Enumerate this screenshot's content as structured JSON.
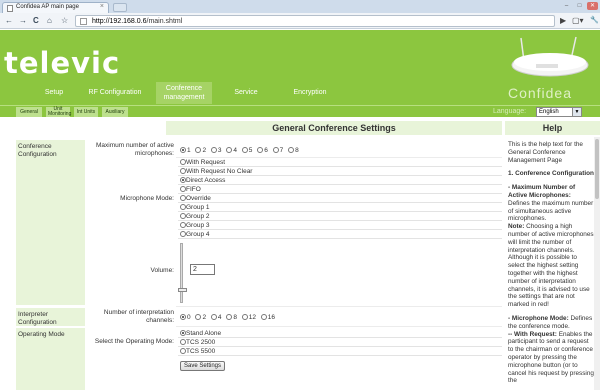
{
  "browser": {
    "tab_title": "Confidea AP main page",
    "tab_close": "×",
    "url_host": "http://192.168.0.6",
    "url_path": "/main.shtml",
    "back": "←",
    "forward": "→",
    "reload": "C",
    "home": "⌂",
    "star": "☆",
    "go": "▶",
    "page_menu": "▢▾",
    "tools_menu": "🔧",
    "win_min": "–",
    "win_max": "□",
    "win_close": "✕"
  },
  "header": {
    "logo": "televic",
    "brand": "Confidea",
    "nav": [
      {
        "label": "Setup"
      },
      {
        "label": "RF Configuration"
      },
      {
        "label": "Conference management"
      },
      {
        "label": "Service"
      },
      {
        "label": "Encryption"
      }
    ],
    "subnav": [
      {
        "label": "General"
      },
      {
        "label": "Unit Monitoring"
      },
      {
        "label": "Int Units"
      },
      {
        "label": "Auxiliary"
      }
    ],
    "language_label": "Language:",
    "language_value": "English"
  },
  "main": {
    "title": "General Conference Settings",
    "sections": {
      "conference": "Conference Configuration",
      "interpreter": "Interpreter Configuration",
      "operating": "Operating Mode"
    },
    "max_mics_label": "Maximum number of active microphones:",
    "max_mics_options": [
      "1",
      "2",
      "3",
      "4",
      "5",
      "6",
      "7",
      "8"
    ],
    "max_mics_selected": "1",
    "mic_mode_label": "Microphone Mode:",
    "mic_mode_options": [
      "With Request",
      "With Request No Clear",
      "Direct Access",
      "FIFO",
      "Override",
      "Group 1",
      "Group 2",
      "Group 3",
      "Group 4"
    ],
    "mic_mode_selected": "Direct Access",
    "volume_label": "Volume:",
    "volume_value": "2",
    "volume_level": 0.2,
    "interp_label": "Number of interpretation channels:",
    "interp_options": [
      "0",
      "2",
      "4",
      "8",
      "12",
      "16"
    ],
    "interp_selected": "0",
    "opmode_label": "Select the Operating Mode:",
    "opmode_options": [
      "Stand Alone",
      "TCS 2500",
      "TCS 5500"
    ],
    "opmode_selected": "Stand Alone",
    "save_label": "Save Settings"
  },
  "help": {
    "title": "Help",
    "p1": "This is the help text for the General Conference Management Page",
    "h1": "1. Conference Configuration",
    "p2a": "- Maximum Number of Active Microphones:",
    "p2b": " Defines the maximum number of simultaneous active microphones.",
    "p3a": "Note:",
    "p3b": " Choosing a high number of active microphones will limit the number of interpretation channels. Although it is possible to select the highest setting together with the highest number of interpretation channels, it is advised to use the settings that are not marked in red!",
    "p4a": "- Microphone Mode:",
    "p4b": " Defines the conference mode.",
    "p5a": "-- With Request:",
    "p5b": " Enables the participant to send a request to the chairman or conference operator by pressing the microphone button (or to cancel his request by pressing the"
  },
  "colors": {
    "brand_green": "#8cc63f",
    "light_green": "#e8f4d9"
  }
}
